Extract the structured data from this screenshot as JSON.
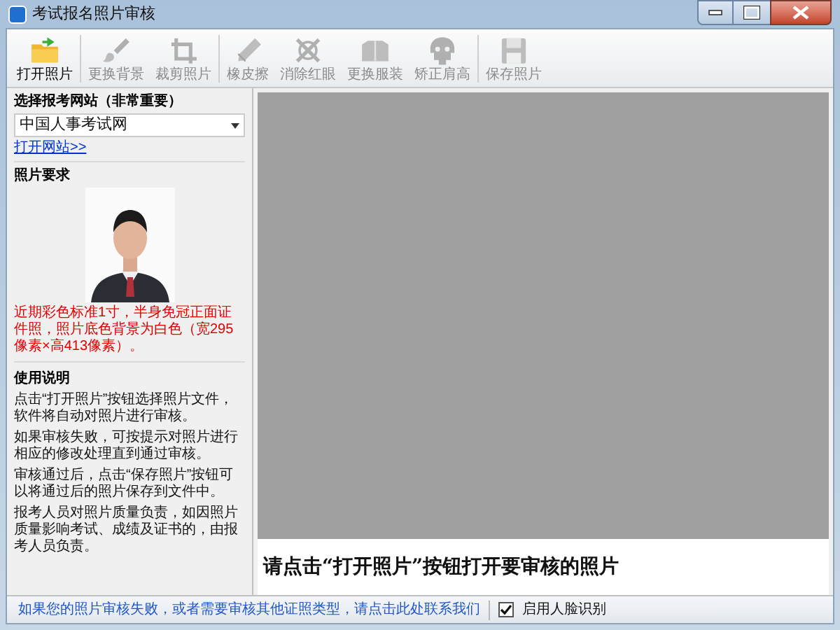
{
  "window": {
    "title": "考试报名照片审核"
  },
  "toolbar": [
    {
      "label": "打开照片",
      "disabled": false
    },
    {
      "label": "更换背景",
      "disabled": true
    },
    {
      "label": "裁剪照片",
      "disabled": true
    },
    {
      "label": "橡皮擦",
      "disabled": true
    },
    {
      "label": "消除红眼",
      "disabled": true
    },
    {
      "label": "更换服装",
      "disabled": true
    },
    {
      "label": "矫正肩高",
      "disabled": true
    },
    {
      "label": "保存照片",
      "disabled": true
    }
  ],
  "site_section": {
    "heading": "选择报考网站（非常重要）",
    "select_value": "中国人事考试网",
    "link": "打开网站>>"
  },
  "photo_section": {
    "heading": "照片要求",
    "requirement": "近期彩色标准1寸，半身免冠正面证件照，照片底色背景为白色（宽295像素×高413像素）。"
  },
  "usage_section": {
    "heading": "使用说明",
    "paragraphs": [
      "点击“打开照片”按钮选择照片文件，软件将自动对照片进行审核。",
      "如果审核失败，可按提示对照片进行相应的修改处理直到通过审核。",
      "审核通过后，点击“保存照片”按钮可以将通过后的照片保存到文件中。",
      "报考人员对照片质量负责，如因照片质量影响考试、成绩及证书的，由报考人员负责。"
    ]
  },
  "message": "请点击“打开照片”按钮打开要审核的照片",
  "status_bar": {
    "link": "如果您的照片审核失败，或者需要审核其他证照类型，请点击此处联系我们",
    "checkbox": {
      "label": "启用人脸识别",
      "checked": true
    }
  }
}
